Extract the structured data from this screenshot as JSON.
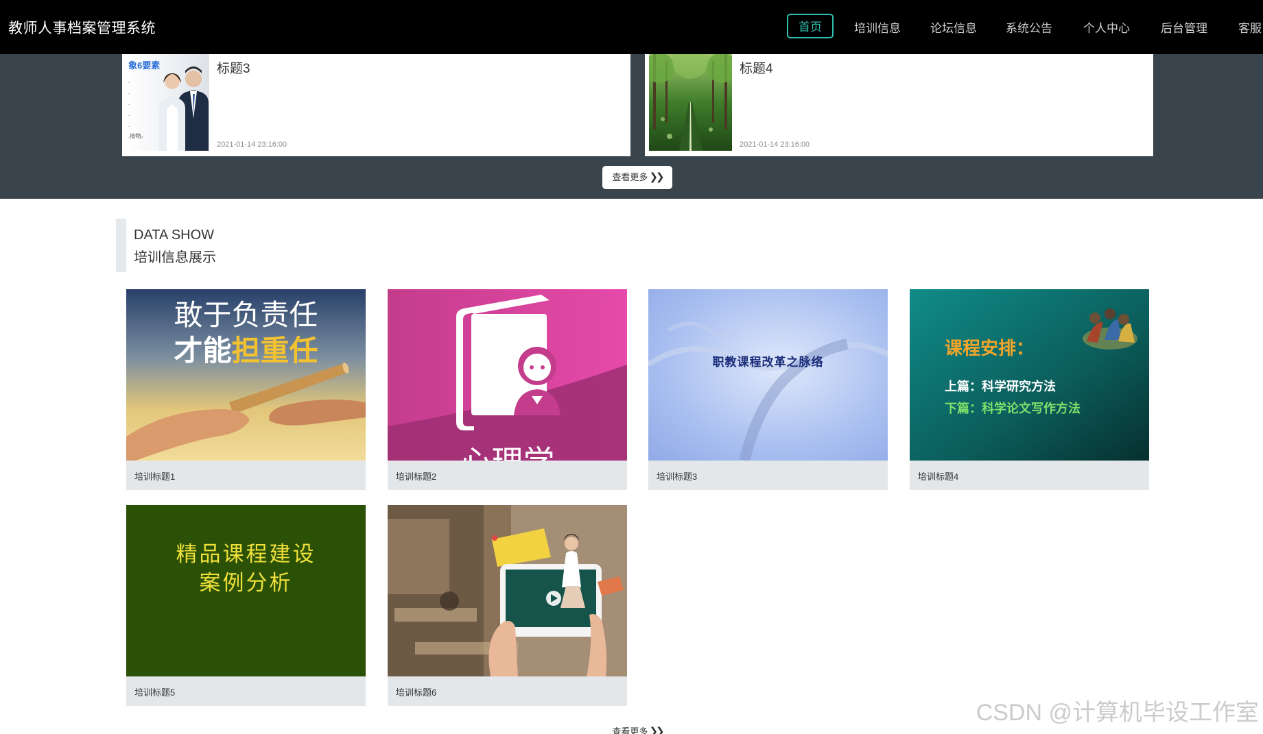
{
  "app": {
    "title": "教师人事档案管理系统"
  },
  "nav": {
    "items": [
      {
        "label": "首页",
        "active": true
      },
      {
        "label": "培训信息"
      },
      {
        "label": "论坛信息"
      },
      {
        "label": "系统公告"
      },
      {
        "label": "个人中心"
      },
      {
        "label": "后台管理"
      },
      {
        "label": "客服"
      }
    ]
  },
  "news": {
    "items": [
      {
        "title": "标题3",
        "date": "2021-01-14 23:16:00",
        "thumb_text": "象6要素",
        "thumb_lines": [
          ".",
          ".",
          ".",
          ".",
          ".",
          ".接物。"
        ]
      },
      {
        "title": "标题4",
        "date": "2021-01-14 23:16:00"
      }
    ],
    "more_label": "查看更多"
  },
  "section": {
    "title_en": "DATA SHOW",
    "title_cn": "培训信息展示"
  },
  "training": {
    "items": [
      {
        "title": "培训标题1",
        "img_line1": "敢于负责任",
        "img_line2a": "才能",
        "img_line2b": "担重任"
      },
      {
        "title": "培训标题2",
        "img_text": "心理学"
      },
      {
        "title": "培训标题3",
        "img_text": "职教课程改革之脉络"
      },
      {
        "title": "培训标题4",
        "img_heading": "课程安排：",
        "img_line1": "上篇：科学研究方法",
        "img_line2": "下篇：科学论文写作方法"
      },
      {
        "title": "培训标题5",
        "img_line1": "精品课程建设",
        "img_line2": "案例分析"
      },
      {
        "title": "培训标题6"
      }
    ],
    "more_label": "查看更多"
  },
  "watermark": "CSDN @计算机毕设工作室",
  "colors": {
    "accent": "#2fbfb0",
    "nav_bg": "#000000",
    "band_bg": "#3a444d",
    "card_bg": "#e3e7ea"
  }
}
